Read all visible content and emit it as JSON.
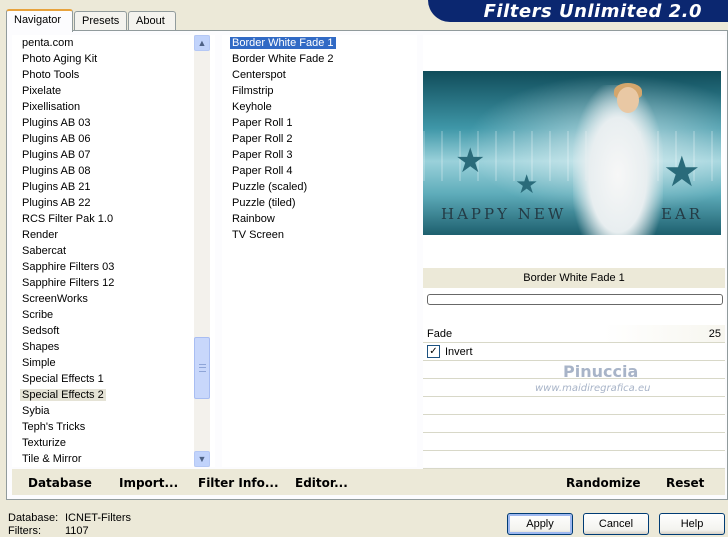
{
  "tabs": [
    {
      "label": "Navigator",
      "active": true
    },
    {
      "label": "Presets",
      "active": false
    },
    {
      "label": "About",
      "active": false
    }
  ],
  "banner": {
    "title": "Filters Unlimited 2.0",
    "color": "#0b2770"
  },
  "categories": {
    "items": [
      "penta.com",
      "Photo Aging Kit",
      "Photo Tools",
      "Pixelate",
      "Pixellisation",
      "Plugins AB 03",
      "Plugins AB 06",
      "Plugins AB 07",
      "Plugins AB 08",
      "Plugins AB 21",
      "Plugins AB 22",
      "RCS Filter Pak 1.0",
      "Render",
      "Sabercat",
      "Sapphire Filters 03",
      "Sapphire Filters 12",
      "ScreenWorks",
      "Scribe",
      "Sedsoft",
      "Shapes",
      "Simple",
      "Special Effects 1",
      "Special Effects 2",
      "Sybia",
      "Teph's Tricks",
      "Texturize",
      "Tile & Mirror"
    ],
    "selected": "Special Effects 2"
  },
  "filters": {
    "items": [
      "Border White Fade 1",
      "Border White Fade 2",
      "Centerspot",
      "Filmstrip",
      "Keyhole",
      "Paper Roll 1",
      "Paper Roll 2",
      "Paper Roll 3",
      "Paper Roll 4",
      "Puzzle (scaled)",
      "Puzzle (tiled)",
      "Rainbow",
      "TV Screen"
    ],
    "selected": "Border White Fade 1"
  },
  "preview": {
    "text_left": "HAPPY NEW",
    "text_right": "EAR"
  },
  "filter_panel": {
    "title": "Border White Fade 1",
    "fade_label": "Fade",
    "fade_value": "25",
    "invert_label": "Invert",
    "invert_checked": true,
    "watermark_name": "Pinuccia",
    "watermark_url": "www.maidiregrafica.eu"
  },
  "toolbar": {
    "database": "Database",
    "import": "Import...",
    "filter_info": "Filter Info...",
    "editor": "Editor...",
    "randomize": "Randomize",
    "reset": "Reset"
  },
  "status": {
    "database_label": "Database:",
    "database_value": "ICNET-Filters",
    "filters_label": "Filters:",
    "filters_value": "1107"
  },
  "buttons": {
    "apply": "Apply",
    "cancel": "Cancel",
    "help": "Help"
  }
}
